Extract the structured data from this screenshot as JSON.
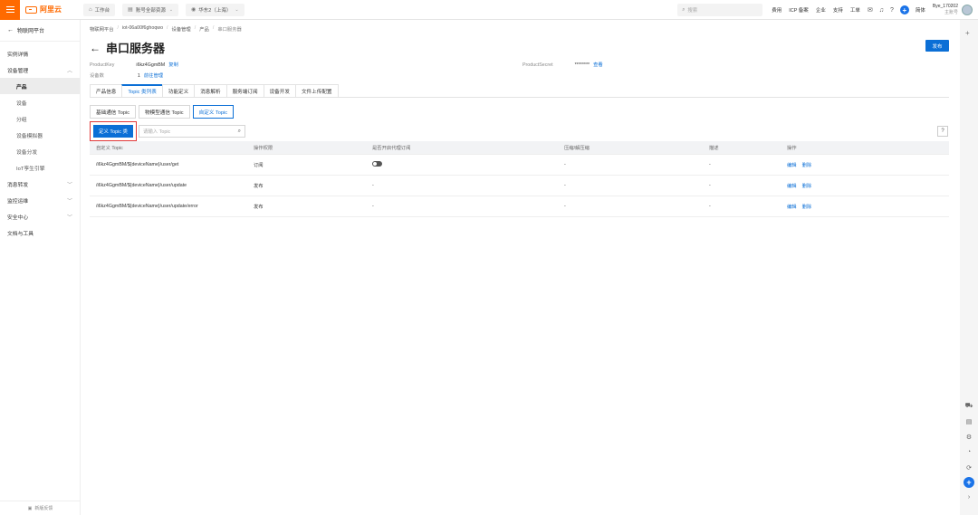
{
  "topbar": {
    "logo_text": "阿里云",
    "workbench": "工作台",
    "resource_group": "账号全部资源",
    "region": "华东2（上海）",
    "search_placeholder": "搜索",
    "links": [
      "费用",
      "ICP 备案",
      "企业",
      "支持",
      "工单"
    ],
    "lang": "简体",
    "user_name": "Bye_170202",
    "user_sub": "主账号"
  },
  "sidebar": {
    "back_label": "物联网平台",
    "items": [
      {
        "label": "实例详情"
      },
      {
        "label": "设备管理"
      },
      {
        "label": "产品"
      },
      {
        "label": "设备"
      },
      {
        "label": "分组"
      },
      {
        "label": "设备模拟器"
      },
      {
        "label": "设备分发"
      },
      {
        "label": "IoT孪生引擎"
      },
      {
        "label": "消息转发"
      },
      {
        "label": "监控运维"
      },
      {
        "label": "安全中心"
      },
      {
        "label": "文档与工具"
      }
    ],
    "footer": "新版反馈"
  },
  "breadcrumb": [
    "物联网平台",
    "iot-06a00f6ghoqwo",
    "设备管理",
    "产品",
    "串口服务器"
  ],
  "page": {
    "title": "串口服务器",
    "publish_label": "发布"
  },
  "meta": {
    "product_key_label": "ProductKey",
    "product_key_value": "i6kz4GgmBM",
    "copy_label": "复制",
    "device_count_label": "设备数",
    "device_count_value": "1",
    "go_manage_label": "前往管理",
    "product_secret_label": "ProductSecret",
    "product_secret_value": "********",
    "view_label": "查看"
  },
  "tabs": [
    "产品信息",
    "Topic 类列表",
    "功能定义",
    "消息解析",
    "服务端订阅",
    "设备开发",
    "文件上传配置"
  ],
  "subtabs": [
    "基础通信 Topic",
    "物模型通信 Topic",
    "自定义 Topic"
  ],
  "toolbar": {
    "define_button": "定义 Topic 类",
    "search_placeholder": "请输入 Topic"
  },
  "table": {
    "headers": [
      "自定义 Topic",
      "操作权限",
      "是否开启代理订阅",
      "压缩/解压缩",
      "描述",
      "操作"
    ],
    "rows": [
      {
        "topic": "/i6kz4GgmBM/${deviceName}/user/get",
        "permission": "订阅",
        "proxy": "toggle",
        "compress": "-",
        "desc": "-",
        "edit": "编辑",
        "delete": "删除"
      },
      {
        "topic": "/i6kz4GgmBM/${deviceName}/user/update",
        "permission": "发布",
        "proxy": "-",
        "compress": "-",
        "desc": "-",
        "edit": "编辑",
        "delete": "删除"
      },
      {
        "topic": "/i6kz4GgmBM/${deviceName}/user/update/error",
        "permission": "发布",
        "proxy": "-",
        "compress": "-",
        "desc": "-",
        "edit": "编辑",
        "delete": "删除"
      }
    ]
  },
  "colors": {
    "brand": "#ff6a00",
    "primary": "#0b6fd6",
    "highlight": "#e23a3a"
  }
}
